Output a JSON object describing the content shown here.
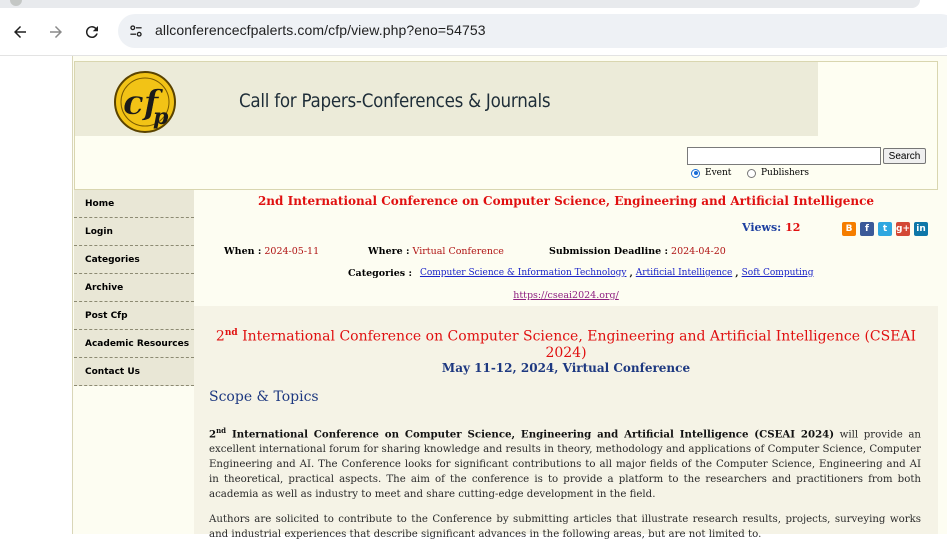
{
  "browser": {
    "url": "allconferencecfpalerts.com/cfp/view.php?eno=54753"
  },
  "header": {
    "logo_text": "cfp",
    "site_title": "Call for Papers-Conferences & Journals",
    "search_placeholder": "",
    "search_button": "Search",
    "radio_event": "Event",
    "radio_publishers": "Publishers",
    "selected_radio": "Event"
  },
  "sidebar": {
    "items": [
      {
        "label": "Home"
      },
      {
        "label": "Login"
      },
      {
        "label": "Categories"
      },
      {
        "label": "Archive"
      },
      {
        "label": "Post Cfp"
      },
      {
        "label": "Academic Resources"
      },
      {
        "label": "Contact Us"
      }
    ]
  },
  "event": {
    "title": "2nd International Conference on Computer Science, Engineering and Artificial Intelligence",
    "views_label": "Views:",
    "views_count": "12",
    "when_label": "When :",
    "when_value": "2024-05-11",
    "where_label": "Where :",
    "where_value": "Virtual Conference",
    "deadline_label": "Submission Deadline :",
    "deadline_value": "2024-04-20",
    "categories_label": "Categories :",
    "categories": [
      "Computer Science & Information Technology",
      "Artificial Intelligence",
      "Soft Computing"
    ],
    "url": "https://cseai2024.org/",
    "share_icons": [
      "blogger-icon",
      "facebook-icon",
      "twitter-icon",
      "googleplus-icon",
      "linkedin-icon"
    ]
  },
  "content": {
    "heading_ordinal": "2",
    "heading_sup": "nd",
    "heading_rest": " International Conference on Computer Science, Engineering and Artificial Intelligence (CSEAI 2024)",
    "date_line": "May 11-12, 2024, Virtual Conference",
    "scope_heading": "Scope & Topics",
    "para1_ordinal": "2",
    "para1_sup": "nd",
    "para1_bold": " International Conference on Computer Science, Engineering and Artificial Intelligence (CSEAI 2024)",
    "para1_rest": " will provide an excellent international forum for sharing knowledge and results in theory, methodology and applications of Computer Science, Computer Engineering and AI. The Conference looks for significant contributions to all major fields of the Computer Science, Engineering and AI in theoretical, practical aspects. The aim of the conference is to provide a platform to the researchers and practitioners from both academia as well as industry to meet and share cutting-edge development in the field.",
    "para2": "Authors are solicited to contribute to the Conference by submitting articles that illustrate research results, projects, surveying works and industrial experiences that describe significant advances in the following areas, but are not limited to."
  }
}
